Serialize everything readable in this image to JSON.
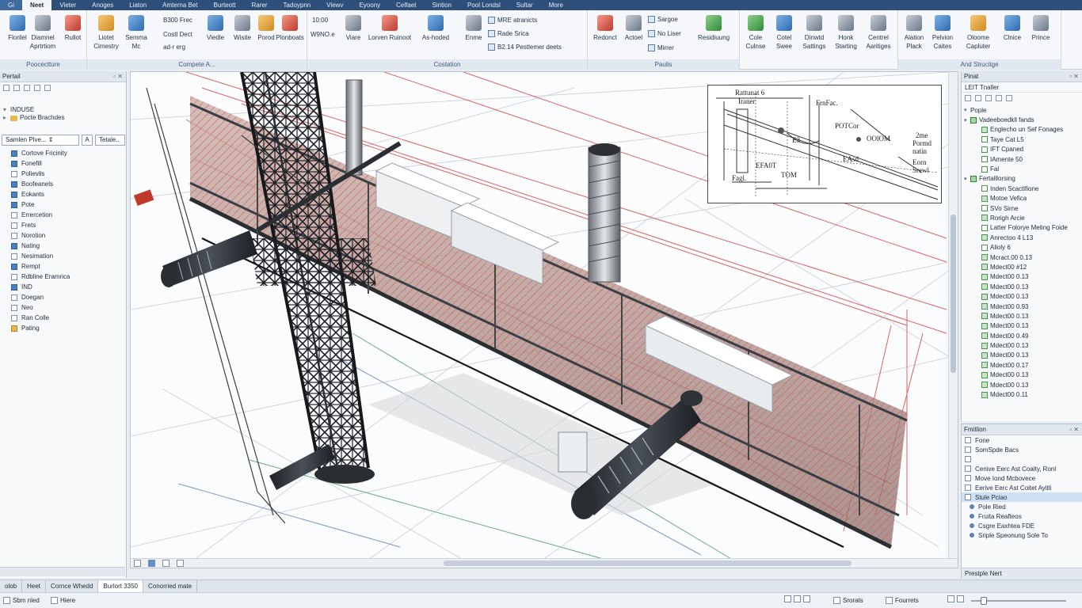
{
  "menu_tabs": [
    "Gi",
    "Neet",
    "Vieter",
    "Anoges",
    "Liaton",
    "Amterna Bet",
    "Burteott",
    "Rarer",
    "Tadoypnn",
    "Viewv",
    "Eyoony",
    "Celfaet",
    "Sintion",
    "Pool Londsl",
    "Sultar",
    "More"
  ],
  "ribbon": {
    "groups": {
      "perspective": "Poocectture",
      "compete": "Compete A...",
      "costation": "Costation",
      "paulis": "Paulis",
      "and_structige": "And Strucitge"
    },
    "buttons": {
      "floritel": "Florilel",
      "diamnel": "Diamnel Aprtrtiom",
      "ruhot": "Rullot",
      "liotet": "Liotet Cimestry",
      "semma": "Semma Mc",
      "b300_frec": "B300 Frec",
      "costl_dect": "Costl Dect",
      "ad_r_erg": "ad-r erg",
      "viedle": "Viedle",
      "wisite": "Wisite",
      "porod": "Porod",
      "plonboats": "Plonboats",
      "b1000": "10:00",
      "w9noe": "W9NO.e",
      "viare": "Viare",
      "lorven": "Lorven Ruinoot",
      "as_hoded": "As-hoded",
      "enme": "Enme",
      "mre_atranicts": "MRE atranicts",
      "rade_srica": "Rade Srica",
      "b2_14": "B2.14 Pestlemer deets",
      "redonct": "Redonct",
      "actoel": "Actoel",
      "sargoe": "Sargoe",
      "no_liser": "No Liser",
      "mirrer": "Mirrer",
      "residiuung": "Residiuung",
      "cole_culnse": "Cole Culnse",
      "cotel_swee": "Cotel Swee",
      "dinwtd_sattings": "Dinwtd Sattings",
      "hunk_starting": "Honk Starting",
      "centrel_aaritiges": "Centrel Aaritiges",
      "alation_plack": "Alation Plack",
      "pelvion_caites": "Pelvion Caites",
      "oloome_capluter": "Oloome Capluter",
      "clnice": "Clnice",
      "prince": "Prince"
    }
  },
  "left_panel": {
    "title": "Pertail",
    "tree": [
      {
        "label": "INDUSE",
        "type": "open"
      },
      {
        "label": "Pocte Brachdes",
        "type": "folder"
      }
    ],
    "dropdown1": "Samlen Plve...",
    "dropdown_btn": "A",
    "dropdown2": "Tetale..",
    "items": [
      {
        "label": "Cortove Fricinity",
        "state": "on"
      },
      {
        "label": "Fonefill",
        "state": "on"
      },
      {
        "label": "Polievils",
        "state": "off"
      },
      {
        "label": "Boofeanels",
        "state": "on"
      },
      {
        "label": "Eokants",
        "state": "on"
      },
      {
        "label": "Pote",
        "state": "on"
      },
      {
        "label": "Errercetion",
        "state": "off"
      },
      {
        "label": "Frets",
        "state": "off"
      },
      {
        "label": "Norotion",
        "state": "off"
      },
      {
        "label": "Nating",
        "state": "on"
      },
      {
        "label": "Nesimation",
        "state": "off"
      },
      {
        "label": "Rempt",
        "state": "on"
      },
      {
        "label": "Rdbline Eramrica",
        "state": "off"
      },
      {
        "label": "IND",
        "state": "on"
      },
      {
        "label": "Doegan",
        "state": "off"
      },
      {
        "label": "Neo",
        "state": "off"
      },
      {
        "label": "Ran Colle",
        "state": "off"
      },
      {
        "label": "Pating",
        "state": "folder"
      }
    ]
  },
  "inset": {
    "labels": [
      "Rattunat 6",
      "Iraner",
      "FrnFac.",
      "POTCor",
      "2me",
      "Pormd",
      "natin",
      "Eorn",
      "Srewl",
      "OOlOM",
      "EFA0T",
      "EAsd",
      "TOM",
      "Fagl.",
      "E3"
    ]
  },
  "right_panel": {
    "title": "Pinat",
    "subtitle": "LEIT Tnaller",
    "root": "Pople",
    "items": [
      {
        "label": "Vadeeboedkll fands",
        "level": 1,
        "kind": "group"
      },
      {
        "label": "Englecho un Sef Fonages",
        "level": 2,
        "kind": "on"
      },
      {
        "label": "Taye Cat L5",
        "level": 2,
        "kind": "off"
      },
      {
        "label": "IFT Cpaned",
        "level": 2,
        "kind": "off"
      },
      {
        "label": "IAmente 50",
        "level": 2,
        "kind": "off"
      },
      {
        "label": "Fal",
        "level": 2,
        "kind": "off"
      },
      {
        "label": "Fertalllorsing",
        "level": 1,
        "kind": "group"
      },
      {
        "label": "Inden Scactifione",
        "level": 2,
        "kind": "off"
      },
      {
        "label": "Motoe Vefica",
        "level": 2,
        "kind": "on"
      },
      {
        "label": "SVo Sirne",
        "level": 2,
        "kind": "off"
      },
      {
        "label": "Rorigh Arcie",
        "level": 2,
        "kind": "on"
      },
      {
        "label": "Latter Folorye Meting Foide",
        "level": 2,
        "kind": "off"
      },
      {
        "label": "Anrectoo 4 L13",
        "level": 2,
        "kind": "on"
      },
      {
        "label": "Alioly 6",
        "level": 2,
        "kind": "off"
      },
      {
        "label": "Mcract.00 0.13",
        "level": 2,
        "kind": "on"
      },
      {
        "label": "Mdect00 #12",
        "level": 2,
        "kind": "on"
      },
      {
        "label": "Mdect00 0.13",
        "level": 2,
        "kind": "on"
      },
      {
        "label": "Mdect00 0.13",
        "level": 2,
        "kind": "on"
      },
      {
        "label": "Mdect00 0.13",
        "level": 2,
        "kind": "on"
      },
      {
        "label": "Mdect00 0.93",
        "level": 2,
        "kind": "on"
      },
      {
        "label": "Mdect00 0.13",
        "level": 2,
        "kind": "on"
      },
      {
        "label": "Mdect00 0.13",
        "level": 2,
        "kind": "on"
      },
      {
        "label": "Mdect00 0.49",
        "level": 2,
        "kind": "on"
      },
      {
        "label": "Mdect00 0.13",
        "level": 2,
        "kind": "on"
      },
      {
        "label": "Mdect00 0.13",
        "level": 2,
        "kind": "on"
      },
      {
        "label": "Mdect00 0.17",
        "level": 2,
        "kind": "on"
      },
      {
        "label": "Mdect00 0.13",
        "level": 2,
        "kind": "on"
      },
      {
        "label": "Mdect00 0.13",
        "level": 2,
        "kind": "on"
      },
      {
        "label": "Mdect00 0.11",
        "level": 2,
        "kind": "on"
      }
    ]
  },
  "properties_panel": {
    "title": "Fmitlion",
    "subtitle": "Fone",
    "rows": [
      {
        "label": "SomSpde Bacs",
        "kind": "cb",
        "selected": false
      },
      {
        "label": "",
        "kind": "cb",
        "selected": false
      },
      {
        "label": "Cenive Eerc Ast Coalty, Ronl",
        "kind": "cb",
        "selected": false
      },
      {
        "label": "Move Iond Mcbovece",
        "kind": "cb",
        "selected": false
      },
      {
        "label": "Eerive Eerc Ast Coitet Ayitli",
        "kind": "cb",
        "selected": false
      },
      {
        "label": "Stule Pciao",
        "kind": "cb",
        "selected": true
      },
      {
        "label": "Pole Ried",
        "kind": "dot",
        "selected": false
      },
      {
        "label": "Fruita Reafteos",
        "kind": "dot",
        "selected": false
      },
      {
        "label": "Csgre Eaxhtea FDE",
        "kind": "dot",
        "selected": false
      },
      {
        "label": "Sriple Speonung Sole To",
        "kind": "dot",
        "selected": false
      }
    ],
    "footer": "Prestple Nert"
  },
  "bottom_tabs": [
    "olob",
    "Heet",
    "Cornce Whedd",
    "Burlort 3350",
    "Conorried mate"
  ],
  "status": {
    "left1": "Sbm nled",
    "left2": "Hiere",
    "mid1": "Srorats",
    "mid2": "Fourrets"
  },
  "colors": {
    "menubar": "#2d4f7a",
    "accent": "#3d5a80",
    "redline": "#d94a4a",
    "steel": "#2f3338"
  }
}
